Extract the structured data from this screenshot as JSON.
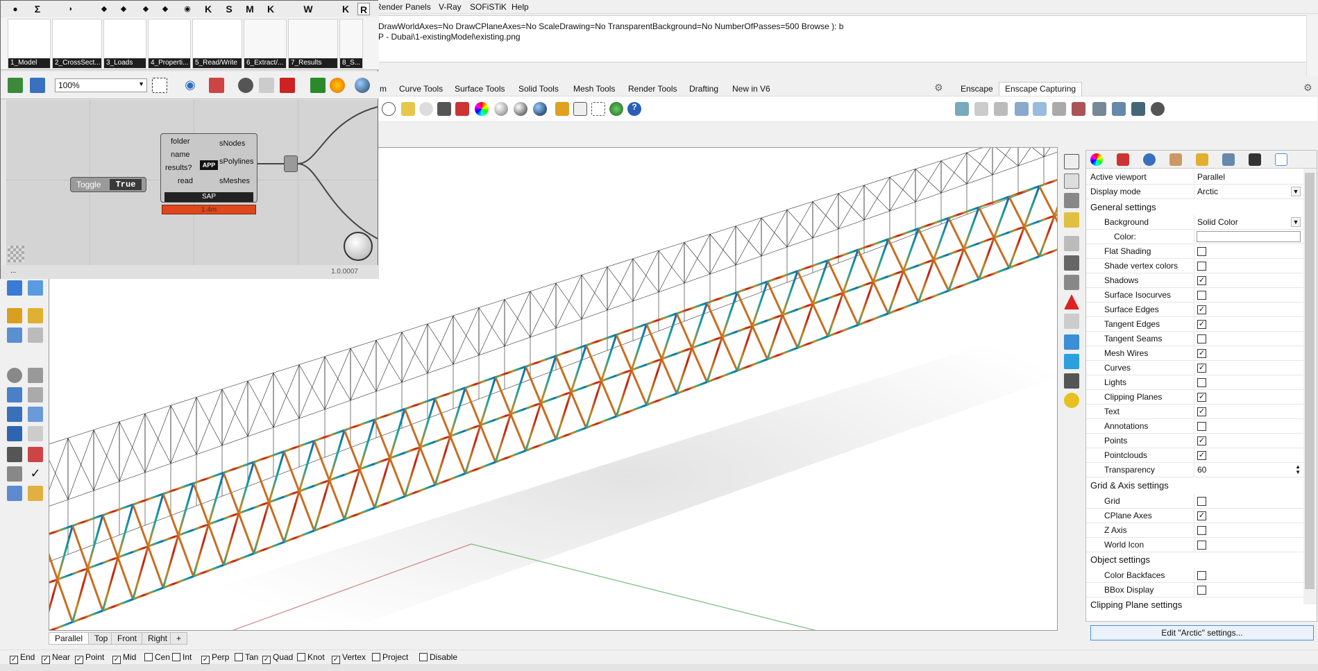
{
  "menu": {
    "items": [
      "Render",
      "Panels",
      "V-Ray",
      "SOFiSTiK",
      "Help"
    ]
  },
  "command_history": [
    "DrawWorldAxes=No  DrawCPlaneAxes=No  ScaleDrawing=No  TransparentBackground=No  NumberOfPasses=500  Browse ): b",
    "P - Dubai\\1-existingModel\\existing.png"
  ],
  "toolbar_tabs": [
    "m",
    "Curve Tools",
    "Surface Tools",
    "Solid Tools",
    "Mesh Tools",
    "Render Tools",
    "Drafting",
    "New in V6"
  ],
  "enscape_tabs": [
    "Enscape",
    "Enscape Capturing"
  ],
  "grasshopper": {
    "tabs": [
      "Σ",
      "K",
      "S",
      "M",
      "K",
      "W",
      "K",
      "R"
    ],
    "groups": [
      "1_Model",
      "2_CrossSect...",
      "3_Loads",
      "4_Properti...",
      "5_Read/Write",
      "6_Extract/...",
      "7_Results",
      "8_S..."
    ],
    "zoom": "100%",
    "component": {
      "inputs": [
        "folder",
        "name",
        "results?",
        "read"
      ],
      "outputs": [
        "sNodes",
        "sPolylines",
        "sMeshes"
      ],
      "title": "SAP",
      "time": "1.4m",
      "icon_text": "APP"
    },
    "toggle": {
      "label": "Toggle",
      "value": "True"
    },
    "version": "1.0.0007",
    "footer_dots": "..."
  },
  "viewport_tabs": [
    "Parallel",
    "Top",
    "Front",
    "Right"
  ],
  "viewport_add": "+",
  "properties": {
    "rows_top": [
      {
        "label": "Active viewport",
        "value": "Parallel"
      },
      {
        "label": "Display mode",
        "value": "Arctic"
      }
    ],
    "general_header": "General settings",
    "background": {
      "label": "Background",
      "value": "Solid Color"
    },
    "color_label": "Color:",
    "general_checks": [
      {
        "label": "Flat Shading",
        "checked": false
      },
      {
        "label": "Shade vertex colors",
        "checked": false
      },
      {
        "label": "Shadows",
        "checked": true
      },
      {
        "label": "Surface Isocurves",
        "checked": false
      },
      {
        "label": "Surface Edges",
        "checked": true
      },
      {
        "label": "Tangent Edges",
        "checked": true
      },
      {
        "label": "Tangent Seams",
        "checked": false
      },
      {
        "label": "Mesh Wires",
        "checked": true
      },
      {
        "label": "Curves",
        "checked": true
      },
      {
        "label": "Lights",
        "checked": false
      },
      {
        "label": "Clipping Planes",
        "checked": true
      },
      {
        "label": "Text",
        "checked": true
      },
      {
        "label": "Annotations",
        "checked": false
      },
      {
        "label": "Points",
        "checked": true
      },
      {
        "label": "Pointclouds",
        "checked": true
      }
    ],
    "transparency": {
      "label": "Transparency",
      "value": "60"
    },
    "grid_header": "Grid & Axis settings",
    "grid_checks": [
      {
        "label": "Grid",
        "checked": false
      },
      {
        "label": "CPlane Axes",
        "checked": true
      },
      {
        "label": "Z Axis",
        "checked": false
      },
      {
        "label": "World Icon",
        "checked": false
      }
    ],
    "object_header": "Object settings",
    "object_checks": [
      {
        "label": "Color Backfaces",
        "checked": false
      },
      {
        "label": "BBox Display",
        "checked": false
      }
    ],
    "clipping_header": "Clipping Plane settings",
    "edit_button": "Edit \"Arctic\" settings...",
    "check_mark": "✓"
  },
  "osnaps": [
    {
      "label": "End",
      "checked": true
    },
    {
      "label": "Near",
      "checked": true
    },
    {
      "label": "Point",
      "checked": true
    },
    {
      "label": "Mid",
      "checked": true
    },
    {
      "label": "Cen",
      "checked": false
    },
    {
      "label": "Int",
      "checked": false
    },
    {
      "label": "Perp",
      "checked": true
    },
    {
      "label": "Tan",
      "checked": false
    },
    {
      "label": "Quad",
      "checked": true
    },
    {
      "label": "Knot",
      "checked": false
    },
    {
      "label": "Vertex",
      "checked": true
    },
    {
      "label": "Project",
      "checked": false
    },
    {
      "label": "Disable",
      "checked": false
    }
  ],
  "colors": {
    "accent": "#4a90d9",
    "gh_timer": "#e0471c",
    "truss_red": "#c21b12",
    "truss_teal": "#1aa59a"
  }
}
